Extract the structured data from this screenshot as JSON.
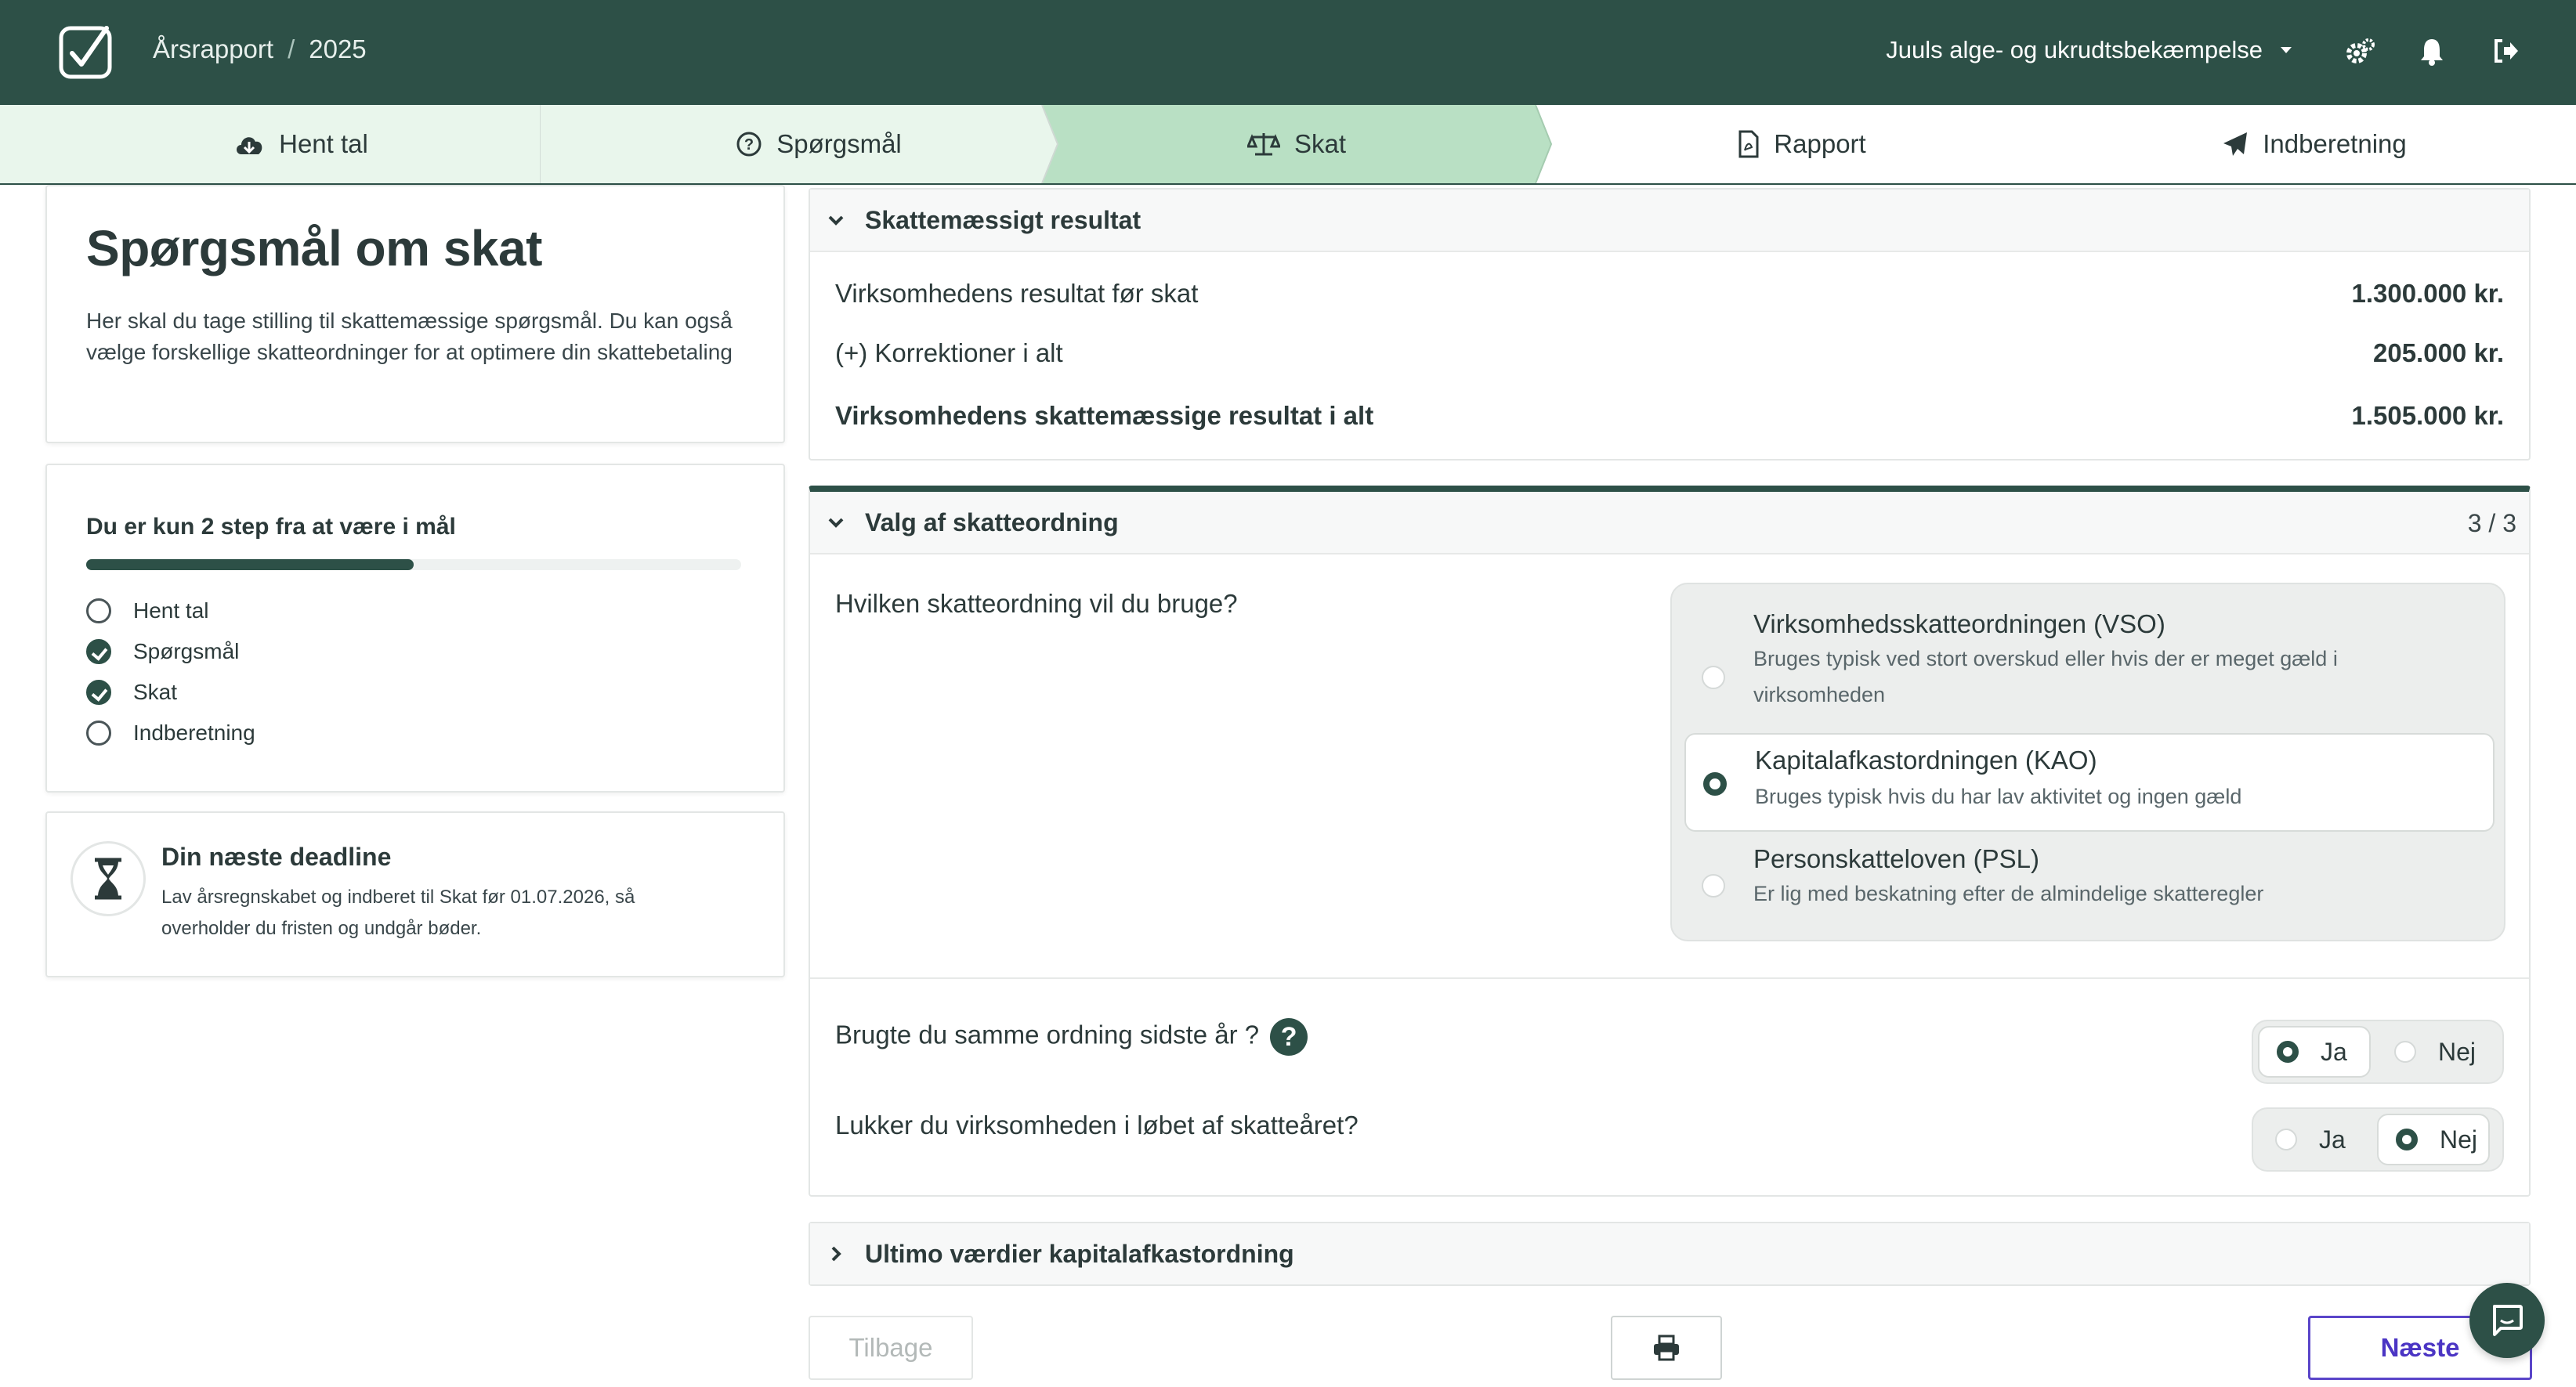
{
  "header": {
    "breadcrumb_root": "Årsrapport",
    "breadcrumb_sep": "/",
    "breadcrumb_year": "2025",
    "company": "Juuls alge- og ukrudtsbekæmpelse"
  },
  "icons": {
    "logo": "checkbox-logo-icon",
    "company_dropdown": "caret-down-icon",
    "settings": "gears-icon",
    "notifications": "bell-icon",
    "logout": "sign-out-icon",
    "step1": "cloud-download-icon",
    "step2": "question-circle-icon",
    "step3": "balance-scale-icon",
    "step4": "pdf-file-icon",
    "step5": "paper-plane-icon",
    "deadline": "hourglass-icon",
    "print": "printer-icon",
    "chat": "chat-bubble-icon"
  },
  "steps": [
    {
      "label": "Hent tal",
      "state": "done"
    },
    {
      "label": "Spørgsmål",
      "state": "done"
    },
    {
      "label": "Skat",
      "state": "active"
    },
    {
      "label": "Rapport",
      "state": "todo"
    },
    {
      "label": "Indberetning",
      "state": "todo"
    }
  ],
  "intro": {
    "title": "Spørgsmål om skat",
    "text": "Her skal du tage stilling til skattemæssige spørgsmål. Du kan også vælge forskellige skatteordninger for at optimere din skattebetaling"
  },
  "progress": {
    "title": "Du er kun 2 step fra at være i mål",
    "fraction": 0.5,
    "items": [
      {
        "label": "Hent tal",
        "done": false
      },
      {
        "label": "Spørgsmål",
        "done": true
      },
      {
        "label": "Skat",
        "done": true
      },
      {
        "label": "Indberetning",
        "done": false
      }
    ]
  },
  "deadline": {
    "title": "Din næste deadline",
    "text": "Lav årsregnskabet og indberet til Skat før 01.07.2026, så overholder du fristen og undgår bøder."
  },
  "result": {
    "title": "Skattemæssigt resultat",
    "rows": [
      {
        "label": "Virksomhedens resultat før skat",
        "value": "1.300.000 kr."
      },
      {
        "label": "(+) Korrektioner i alt",
        "value": "205.000 kr."
      },
      {
        "label": "Virksomhedens skattemæssige resultat i alt",
        "value": "1.505.000 kr."
      }
    ]
  },
  "scheme": {
    "title": "Valg af skatteordning",
    "counter": "3 / 3",
    "question": "Hvilken skatteordning vil du bruge?",
    "options": [
      {
        "title": "Virksomhedsskatteordningen (VSO)",
        "desc": "Bruges typisk ved stort overskud eller hvis der er meget gæld i virksomheden",
        "selected": false
      },
      {
        "title": "Kapitalafkastordningen (KAO)",
        "desc": "Bruges typisk hvis du har lav aktivitet og ingen gæld",
        "selected": true
      },
      {
        "title": "Personskatteloven (PSL)",
        "desc": "Er lig med beskatning efter de almindelige skatteregler",
        "selected": false
      }
    ],
    "q_same": "Brugte du samme ordning sidste år ?",
    "q_same_help": "?",
    "q_close": "Lukker du virksomheden i løbet af skatteåret?",
    "yes": "Ja",
    "no": "Nej",
    "same_answer": "Ja",
    "close_answer": "Nej"
  },
  "ultimo": {
    "title": "Ultimo værdier kapitalafkastordning"
  },
  "footer": {
    "back": "Tilbage",
    "next": "Næste"
  },
  "colors": {
    "brand": "#2d5047",
    "active_step": "#b9e0c4",
    "done_step": "#e9f6ec",
    "next_button": "#4b35c4"
  }
}
